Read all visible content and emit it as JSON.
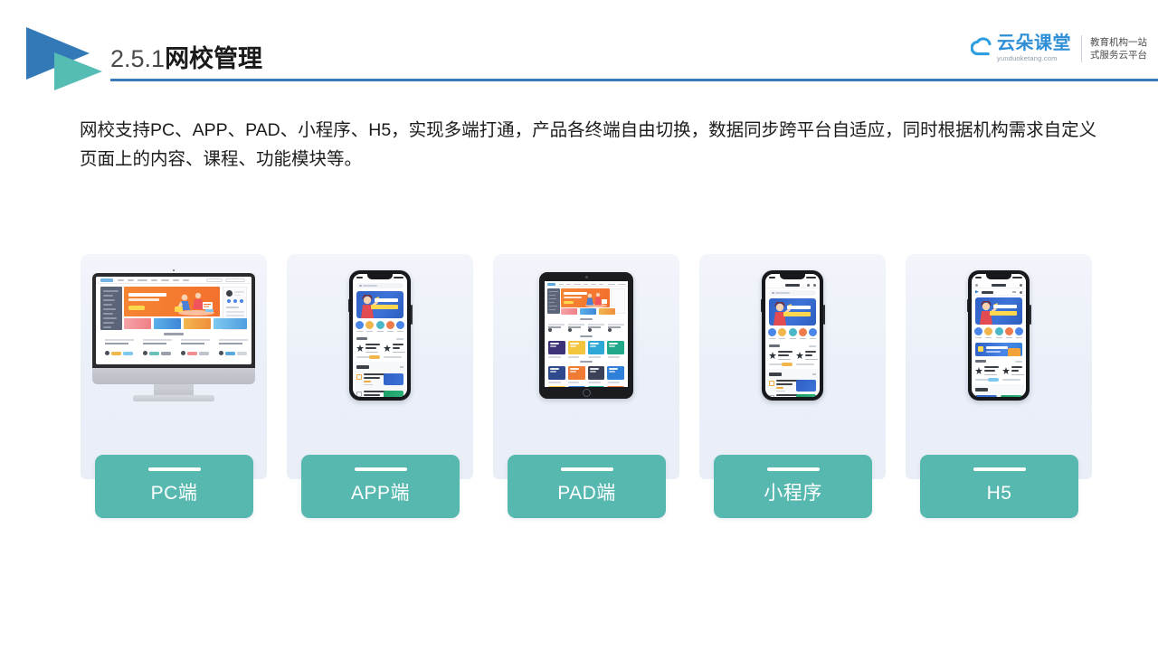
{
  "header": {
    "logo_icon": "double-triangle-play-logo",
    "title_number": "2.5.1",
    "title_name": "网校管理",
    "rule_color": "#3a7cb8"
  },
  "brand": {
    "cloud_icon": "cloud-icon",
    "name_cn": "云朵课堂",
    "domain": "yunduoketang.com",
    "tagline_line1": "教育机构一站",
    "tagline_line2": "式服务云平台",
    "color": "#2e8fd6"
  },
  "lead": {
    "paragraph": "网校支持PC、APP、PAD、小程序、H5，实现多端打通，产品各终端自由切换，数据同步跨平台自适应，同时根据机构需求自定义页面上的内容、课程、功能模块等。"
  },
  "cards": [
    {
      "label": "PC端",
      "device": "desktop-monitor",
      "device_icon": "imac-icon"
    },
    {
      "label": "APP端",
      "device": "smartphone",
      "device_icon": "iphone-icon"
    },
    {
      "label": "PAD端",
      "device": "tablet",
      "device_icon": "ipad-icon"
    },
    {
      "label": "小程序",
      "device": "smartphone",
      "device_icon": "iphone-icon"
    },
    {
      "label": "H5",
      "device": "smartphone",
      "device_icon": "iphone-icon"
    }
  ],
  "theme": {
    "label_box_color": "#57b8b0",
    "card_bg_color": "#eef2f9",
    "accent_blue": "#3a7cb8",
    "hero_orange": "#f3702c",
    "banner_blue": "#2f5fc4"
  },
  "mockup_text": {
    "app_banner_line1": "职场人的",
    "app_banner_line2": "第一堂写作课"
  }
}
